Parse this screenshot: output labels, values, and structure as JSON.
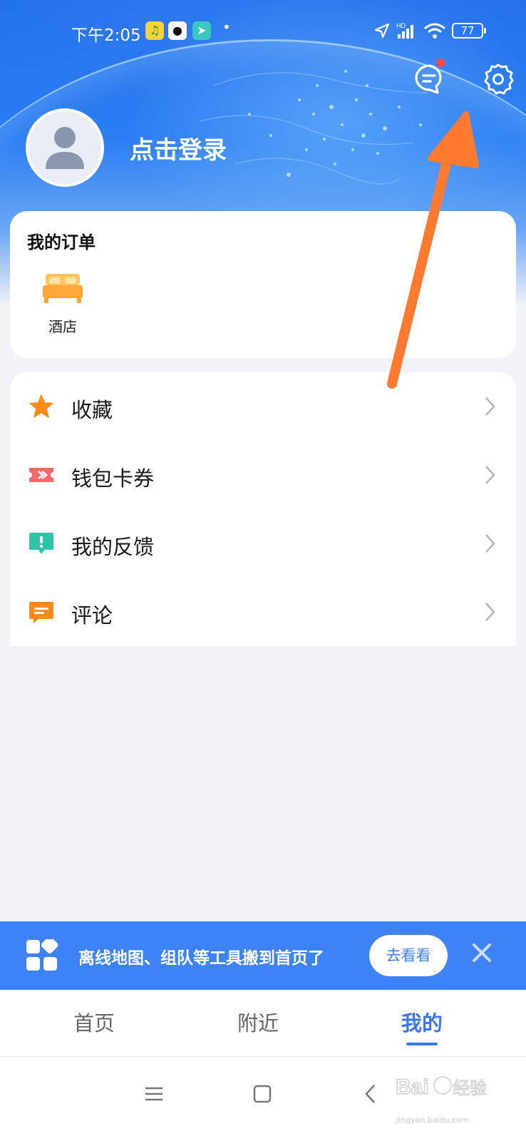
{
  "status_bar": {
    "time": "下午2:05",
    "battery": "77",
    "signal_label": "HD"
  },
  "header": {
    "login_text": "点击登录",
    "message_icon": "message-icon",
    "settings_icon": "gear-icon"
  },
  "orders": {
    "title": "我的订单",
    "items": [
      {
        "label": "酒店",
        "icon": "hotel-bed-icon"
      }
    ]
  },
  "menu": {
    "items": [
      {
        "label": "收藏",
        "icon": "star-icon",
        "color": "#ff8a1a"
      },
      {
        "label": "钱包卡券",
        "icon": "ticket-icon",
        "color": "#f56a6a"
      },
      {
        "label": "我的反馈",
        "icon": "feedback-icon",
        "color": "#2fc4a8"
      },
      {
        "label": "评论",
        "icon": "comment-icon",
        "color": "#ff8a1a"
      }
    ]
  },
  "banner": {
    "text": "离线地图、组队等工具搬到首页了",
    "button_label": "去看看"
  },
  "tabs": [
    {
      "label": "首页",
      "active": false
    },
    {
      "label": "附近",
      "active": false
    },
    {
      "label": "我的",
      "active": true
    }
  ],
  "watermark": {
    "brand": "Baidu",
    "suffix": "经验",
    "url": "jingyan.baidu.com"
  },
  "colors": {
    "accent": "#3778f0",
    "banner": "#3d82f6",
    "arrow": "#ff7a2e"
  }
}
